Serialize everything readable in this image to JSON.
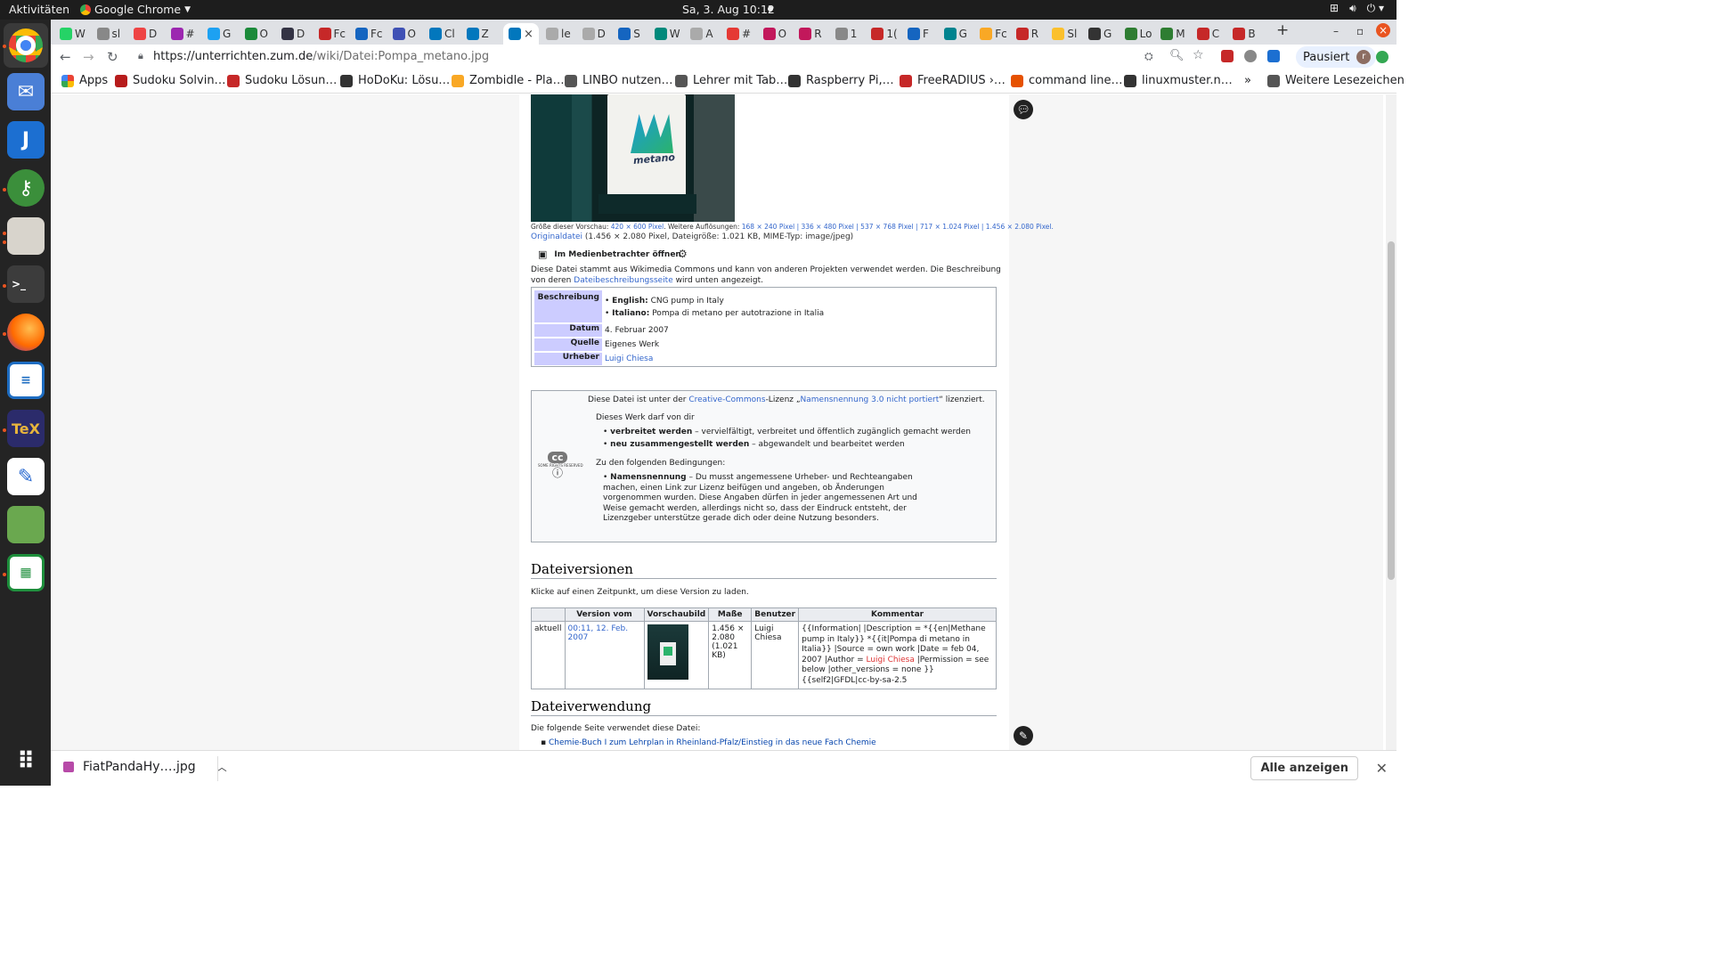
{
  "system": {
    "activities": "Aktivitäten",
    "app_name": "Google Chrome",
    "clock": "Sa, 3. Aug  10:12"
  },
  "tabs": [
    {
      "label": "W",
      "color": "#25d366"
    },
    {
      "label": "sl",
      "color": "#888"
    },
    {
      "label": "D",
      "color": "#e44"
    },
    {
      "label": "#",
      "color": "#9c27b0"
    },
    {
      "label": "G",
      "color": "#1da1f2"
    },
    {
      "label": "O",
      "color": "#1b8a3a"
    },
    {
      "label": "D",
      "color": "#334"
    },
    {
      "label": "Fc",
      "color": "#c62828"
    },
    {
      "label": "Fc",
      "color": "#1565c0"
    },
    {
      "label": "O",
      "color": "#3f51b5"
    },
    {
      "label": "Cl",
      "color": "#0277bd"
    },
    {
      "label": "Z",
      "color": "#0277bd"
    }
  ],
  "active_tab": {
    "label": "",
    "close": "×"
  },
  "tabs_right": [
    {
      "label": "le",
      "color": "#aaa"
    },
    {
      "label": "D",
      "color": "#aaa"
    },
    {
      "label": "S",
      "color": "#1565c0"
    },
    {
      "label": "W",
      "color": "#00897b"
    },
    {
      "label": "A",
      "color": "#aaa"
    },
    {
      "label": "#",
      "color": "#e53935"
    },
    {
      "label": "O",
      "color": "#c2185b"
    },
    {
      "label": "R",
      "color": "#c2185b"
    },
    {
      "label": "1",
      "color": "#888"
    },
    {
      "label": "1(",
      "color": "#c62828"
    },
    {
      "label": "F",
      "color": "#1565c0"
    },
    {
      "label": "G",
      "color": "#00838f"
    },
    {
      "label": "Fc",
      "color": "#f9a825"
    },
    {
      "label": "R",
      "color": "#c62828"
    },
    {
      "label": "Sl",
      "color": "#fbc02d"
    },
    {
      "label": "G",
      "color": "#333"
    },
    {
      "label": "Lo",
      "color": "#2e7d32"
    },
    {
      "label": "M",
      "color": "#2e7d32"
    },
    {
      "label": "C",
      "color": "#c62828"
    },
    {
      "label": "B",
      "color": "#c62828"
    }
  ],
  "toolbar": {
    "url_host": "https://unterrichten.zum.de",
    "url_path": "/wiki/Datei:Pompa_metano.jpg",
    "paused": "Pausiert",
    "avatar_letter": "r"
  },
  "bookmarks": [
    {
      "label": "Apps",
      "color": "#4285f4"
    },
    {
      "label": "Sudoku Solvin…",
      "color": "#b71c1c"
    },
    {
      "label": "Sudoku Lösun…",
      "color": "#c62828"
    },
    {
      "label": "HoDoKu: Lösu…",
      "color": "#333"
    },
    {
      "label": "Zombidle - Pla…",
      "color": "#f9a825"
    },
    {
      "label": "LINBO nutzen…",
      "color": "#555"
    },
    {
      "label": "Lehrer mit Tab…",
      "color": "#555"
    },
    {
      "label": "Raspberry Pi,…",
      "color": "#333"
    },
    {
      "label": "FreeRADIUS ›…",
      "color": "#c62828"
    },
    {
      "label": "command line…",
      "color": "#e65100"
    },
    {
      "label": "linuxmuster.n…",
      "color": "#333"
    },
    {
      "label": "»",
      "color": ""
    },
    {
      "label": "Weitere Lesezeichen",
      "color": "#555"
    }
  ],
  "file": {
    "preview_size_label": "Größe dieser Vorschau: ",
    "preview_size": "420 × 600 Pixel",
    "more_res_label": ". Weitere Auflösungen: ",
    "resolutions": "168 × 240 Pixel | 336 × 480 Pixel | 537 × 768 Pixel | 717 × 1.024 Pixel | 1.456 × 2.080 Pixel.",
    "original_link": "Originaldatei",
    "original_info": " (1.456 × 2.080 Pixel, Dateigröße: 1.021 KB, MIME-Typ: image/jpeg)",
    "media_viewer": "Im Medienbetrachter öffnen",
    "commons_note": "Diese Datei stammt aus Wikimedia Commons und kann von anderen Projekten verwendet werden. Die Beschreibung von deren",
    "commons_link": "Dateibeschreibungsseite",
    "commons_note2": " wird unten angezeigt.",
    "logo_text": "metano"
  },
  "description": {
    "label_desc": "Beschreibung",
    "en_label": "English:",
    "en_text": " CNG pump in Italy",
    "it_label": "Italiano:",
    "it_text": " Pompa di metano per autotrazione in Italia",
    "label_date": "Datum",
    "date": "4. Februar 2007",
    "label_source": "Quelle",
    "source": "Eigenes Werk",
    "label_author": "Urheber",
    "author": "Luigi Chiesa"
  },
  "license": {
    "line1_a": "Diese Datei ist unter der ",
    "line1_link1": "Creative-Commons",
    "line1_b": "-Lizenz „",
    "line1_link2": "Namensnennung 3.0 nicht portiert",
    "line1_c": "“ lizenziert.",
    "may": "Dieses Werk darf von dir",
    "b1_bold": "verbreitet werden",
    "b1_text": " – vervielfältigt, verbreitet und öffentlich zugänglich gemacht werden",
    "b2_bold": "neu zusammengestellt werden",
    "b2_text": " – abgewandelt und bearbeitet werden",
    "conditions": "Zu den folgenden Bedingungen:",
    "c1_bold": "Namensnennung",
    "c1_text": " – Du musst angemessene Urheber- und Rechteangaben machen, einen Link zur Lizenz beifügen und angeben, ob Änderungen vorgenommen wurden. Diese Angaben dürfen in jeder angemessenen Art und Weise gemacht werden, allerdings nicht so, dass der Eindruck entsteht, der Lizenzgeber unterstütze gerade dich oder deine Nutzung besonders.",
    "cc_logo": "cc",
    "cc_small": "SOME RIGHTS RESERVED"
  },
  "versions": {
    "heading": "Dateiversionen",
    "hint": "Klicke auf einen Zeitpunkt, um diese Version zu laden.",
    "headers": [
      "",
      "Version vom",
      "Vorschaubild",
      "Maße",
      "Benutzer",
      "Kommentar"
    ],
    "row": {
      "state": "aktuell",
      "date": "00:11, 12. Feb. 2007",
      "dims": "1.456 × 2.080 (1.021 KB)",
      "user": "Luigi Chiesa",
      "comment_a": "{{Information| |Description = *{{en|Methane pump in Italy}} *{{it|Pompa di metano in Italia}} |Source = own work |Date = feb 04, 2007 |Author = ",
      "comment_link": "Luigi Chiesa",
      "comment_b": " |Permission = see below |other_versions = none }} {{self2|GFDL|cc-by-sa-2.5"
    }
  },
  "usage": {
    "heading": "Dateiverwendung",
    "intro": "Die folgende Seite verwendet diese Datei:",
    "item": "Chemie-Buch I zum Lehrplan in Rheinland-Pfalz/Einstieg in das neue Fach Chemie"
  },
  "download_bar": {
    "filename": "FiatPandaHy….jpg",
    "show_all": "Alle anzeigen"
  }
}
